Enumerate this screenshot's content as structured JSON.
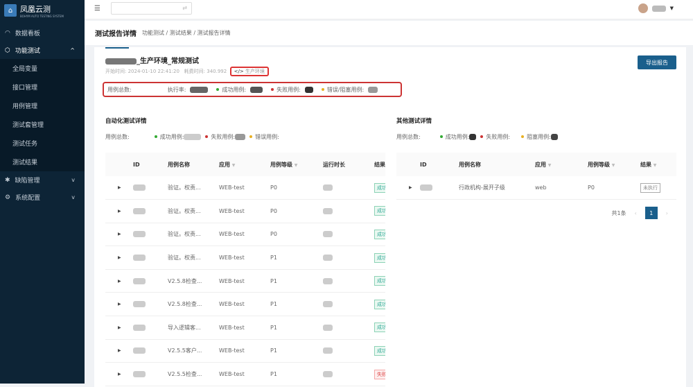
{
  "app": {
    "title": "凤凰云测",
    "subtitle": "BOHYM AUTO TESTING SYSTEM"
  },
  "sidebar": {
    "items": [
      {
        "label": "数据看板",
        "icon": "dashboard-icon"
      },
      {
        "label": "功能测试",
        "icon": "cube-icon",
        "expanded": true,
        "children": [
          "全局变量",
          "接口管理",
          "用例管理",
          "测试套管理",
          "测试任务",
          "测试结果"
        ]
      },
      {
        "label": "缺陷管理",
        "icon": "bug-icon"
      },
      {
        "label": "系统配置",
        "icon": "gear-icon"
      }
    ]
  },
  "breadcrumb": {
    "title": "测试报告详情",
    "path": "功能测试  /  测试结果  /  测试报告详情"
  },
  "report": {
    "title": "_生产环境_常规测试",
    "start_label": "开始时间:",
    "start": "2024-01-10 22:41:20",
    "duration_label": "耗费时间:",
    "duration": "340.992",
    "env": "生产环境",
    "export": "导出报告",
    "summary": {
      "total": "用例总数:",
      "rate": "执行率:",
      "success": "成功用例:",
      "fail": "失败用例:",
      "error": "错误/阻塞用例:"
    }
  },
  "auto": {
    "title": "自动化测试详情",
    "stats": {
      "total": "用例总数:",
      "success": "成功用例:",
      "fail": "失败用例:",
      "error": "错误用例:"
    },
    "columns": [
      "ID",
      "用例名称",
      "应用",
      "用例等级",
      "运行时长",
      "结果"
    ],
    "rows": [
      {
        "name": "验证。权责...",
        "app": "WEB-test",
        "level": "P0",
        "result": "成功"
      },
      {
        "name": "验证。权责...",
        "app": "WEB-test",
        "level": "P0",
        "result": "成功"
      },
      {
        "name": "验证。权责...",
        "app": "WEB-test",
        "level": "P0",
        "result": "成功"
      },
      {
        "name": "验证。权责...",
        "app": "WEB-test",
        "level": "P1",
        "result": "成功"
      },
      {
        "name": "V2.5.8检查...",
        "app": "WEB-test",
        "level": "P1",
        "result": "成功"
      },
      {
        "name": "V2.5.8检查...",
        "app": "WEB-test",
        "level": "P1",
        "result": "成功"
      },
      {
        "name": "导入逻辑客...",
        "app": "WEB-test",
        "level": "P1",
        "result": "成功"
      },
      {
        "name": "V2.5.5客户...",
        "app": "WEB-test",
        "level": "P1",
        "result": "成功"
      },
      {
        "name": "V2.5.5检查...",
        "app": "WEB-test",
        "level": "P1",
        "result": "失败"
      }
    ]
  },
  "other": {
    "title": "其他测试详情",
    "stats": {
      "total": "用例总数:",
      "success": "成功用例:",
      "fail": "失败用例:",
      "block": "阻塞用例:"
    },
    "columns": [
      "ID",
      "用例名称",
      "应用",
      "用例等级",
      "结果"
    ],
    "rows": [
      {
        "name": "行政机构-展开子级",
        "app": "web",
        "level": "P0",
        "result": "未执行"
      }
    ],
    "pager": {
      "total": "共1条",
      "page": "1",
      "prev": "‹",
      "next": "›"
    }
  }
}
